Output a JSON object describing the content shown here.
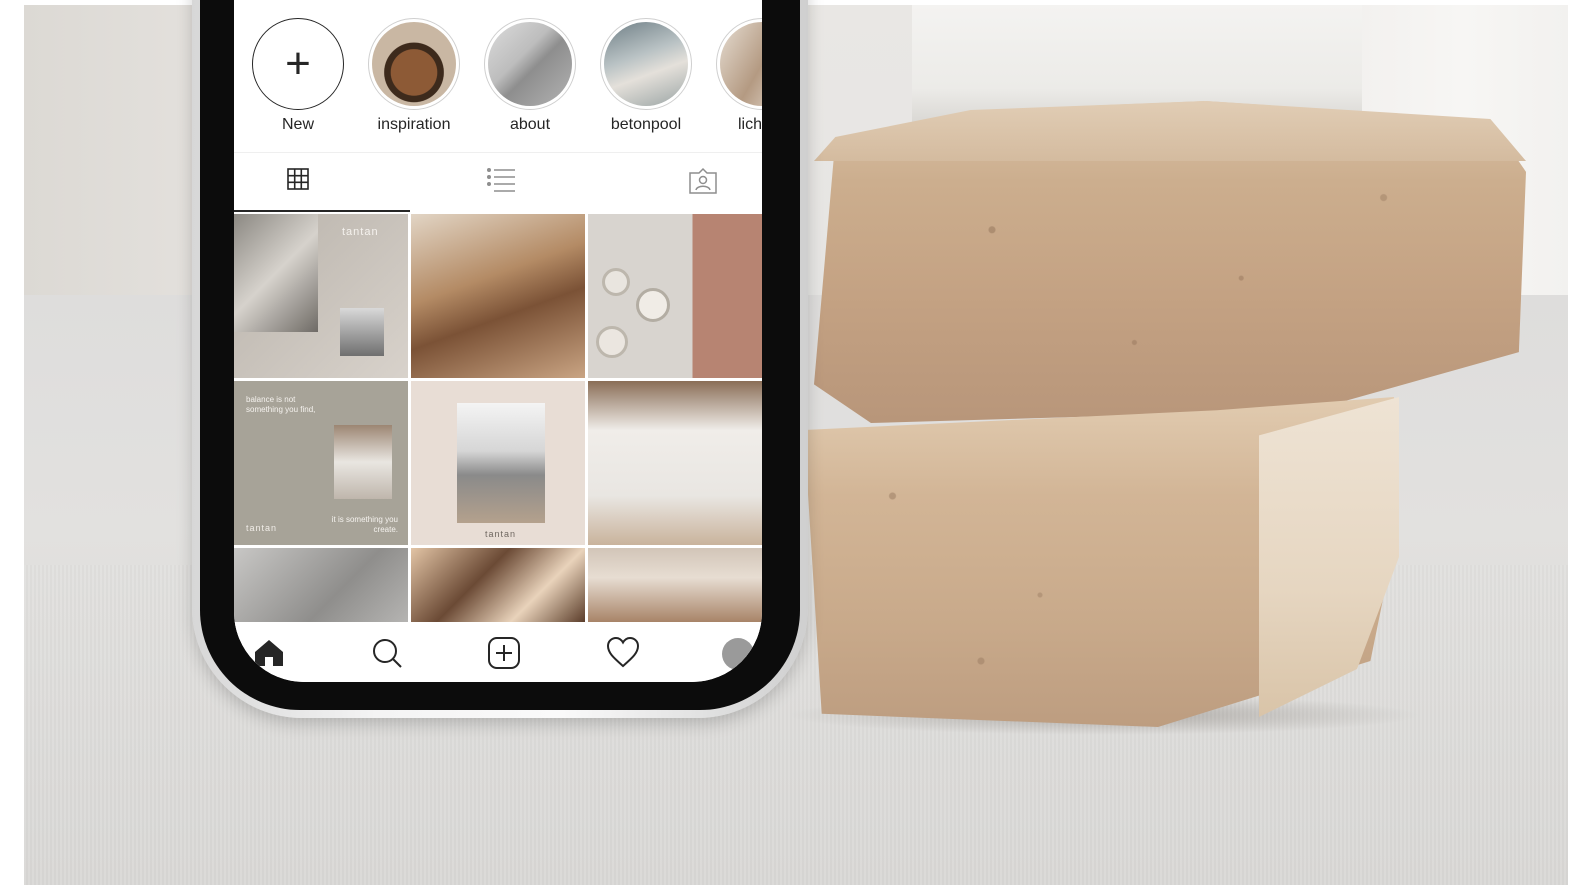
{
  "highlights": [
    {
      "label": "New"
    },
    {
      "label": "inspiration"
    },
    {
      "label": "about"
    },
    {
      "label": "betonpool"
    },
    {
      "label": "lich"
    }
  ],
  "grid": {
    "posts": [
      {
        "brand": "tantan"
      },
      {},
      {},
      {
        "quote_top": "balance is not something you find,",
        "quote_bottom": "it is something you create.",
        "brand": "tantan"
      },
      {
        "brand": "tantan"
      },
      {},
      {},
      {},
      {}
    ]
  },
  "tabs": [
    {
      "icon": "grid-icon",
      "active": true
    },
    {
      "icon": "list-icon",
      "active": false
    },
    {
      "icon": "tagged-icon",
      "active": false
    }
  ],
  "bottom_nav": [
    {
      "icon": "home-icon"
    },
    {
      "icon": "search-icon"
    },
    {
      "icon": "add-post-icon"
    },
    {
      "icon": "heart-icon"
    },
    {
      "icon": "profile-avatar"
    }
  ],
  "colors": {
    "text": "#262626",
    "stone": "#c8a98a",
    "background": "#e4e3e1"
  }
}
